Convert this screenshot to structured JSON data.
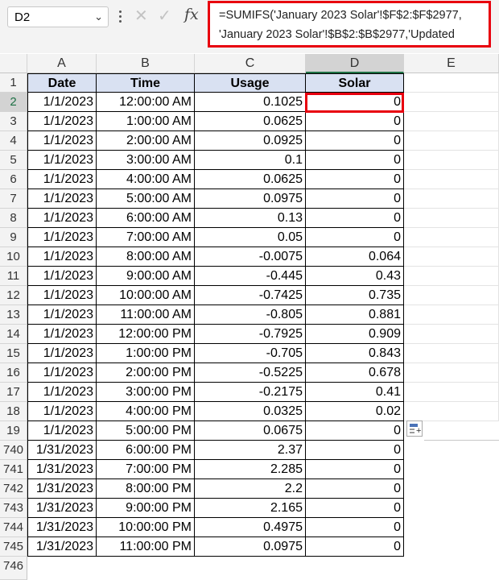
{
  "toolbar": {
    "name_box": "D2",
    "fx_label": "fx",
    "formula_lines": [
      "=SUMIFS('January 2023 Solar'!$F$2:$F$2977,",
      "'January 2023 Solar'!$B$2:$B$2977,'Updated"
    ]
  },
  "grid": {
    "columns": [
      "A",
      "B",
      "C",
      "D",
      "E"
    ],
    "header_row_number": "1",
    "headers": [
      "Date",
      "Time",
      "Usage",
      "Solar"
    ],
    "rows": [
      {
        "n": "2",
        "date": "1/1/2023",
        "time": "12:00:00 AM",
        "usage": "0.1025",
        "solar": "0"
      },
      {
        "n": "3",
        "date": "1/1/2023",
        "time": "1:00:00 AM",
        "usage": "0.0625",
        "solar": "0"
      },
      {
        "n": "4",
        "date": "1/1/2023",
        "time": "2:00:00 AM",
        "usage": "0.0925",
        "solar": "0"
      },
      {
        "n": "5",
        "date": "1/1/2023",
        "time": "3:00:00 AM",
        "usage": "0.1",
        "solar": "0"
      },
      {
        "n": "6",
        "date": "1/1/2023",
        "time": "4:00:00 AM",
        "usage": "0.0625",
        "solar": "0"
      },
      {
        "n": "7",
        "date": "1/1/2023",
        "time": "5:00:00 AM",
        "usage": "0.0975",
        "solar": "0"
      },
      {
        "n": "8",
        "date": "1/1/2023",
        "time": "6:00:00 AM",
        "usage": "0.13",
        "solar": "0"
      },
      {
        "n": "9",
        "date": "1/1/2023",
        "time": "7:00:00 AM",
        "usage": "0.05",
        "solar": "0"
      },
      {
        "n": "10",
        "date": "1/1/2023",
        "time": "8:00:00 AM",
        "usage": "-0.0075",
        "solar": "0.064"
      },
      {
        "n": "11",
        "date": "1/1/2023",
        "time": "9:00:00 AM",
        "usage": "-0.445",
        "solar": "0.43"
      },
      {
        "n": "12",
        "date": "1/1/2023",
        "time": "10:00:00 AM",
        "usage": "-0.7425",
        "solar": "0.735"
      },
      {
        "n": "13",
        "date": "1/1/2023",
        "time": "11:00:00 AM",
        "usage": "-0.805",
        "solar": "0.881"
      },
      {
        "n": "14",
        "date": "1/1/2023",
        "time": "12:00:00 PM",
        "usage": "-0.7925",
        "solar": "0.909"
      },
      {
        "n": "15",
        "date": "1/1/2023",
        "time": "1:00:00 PM",
        "usage": "-0.705",
        "solar": "0.843"
      },
      {
        "n": "16",
        "date": "1/1/2023",
        "time": "2:00:00 PM",
        "usage": "-0.5225",
        "solar": "0.678"
      },
      {
        "n": "17",
        "date": "1/1/2023",
        "time": "3:00:00 PM",
        "usage": "-0.2175",
        "solar": "0.41"
      },
      {
        "n": "18",
        "date": "1/1/2023",
        "time": "4:00:00 PM",
        "usage": "0.0325",
        "solar": "0.02"
      },
      {
        "n": "19",
        "date": "1/1/2023",
        "time": "5:00:00 PM",
        "usage": "0.0675",
        "solar": "0"
      },
      {
        "n": "740",
        "date": "1/31/2023",
        "time": "6:00:00 PM",
        "usage": "2.37",
        "solar": "0"
      },
      {
        "n": "741",
        "date": "1/31/2023",
        "time": "7:00:00 PM",
        "usage": "2.285",
        "solar": "0"
      },
      {
        "n": "742",
        "date": "1/31/2023",
        "time": "8:00:00 PM",
        "usage": "2.2",
        "solar": "0"
      },
      {
        "n": "743",
        "date": "1/31/2023",
        "time": "9:00:00 PM",
        "usage": "2.165",
        "solar": "0"
      },
      {
        "n": "744",
        "date": "1/31/2023",
        "time": "10:00:00 PM",
        "usage": "0.4975",
        "solar": "0"
      },
      {
        "n": "745",
        "date": "1/31/2023",
        "time": "11:00:00 PM",
        "usage": "0.0975",
        "solar": "0"
      }
    ],
    "empty_row_number": "746",
    "selected_cell": "D2",
    "highlight_color": "#e8000e",
    "header_fill": "#d9e1f2"
  }
}
